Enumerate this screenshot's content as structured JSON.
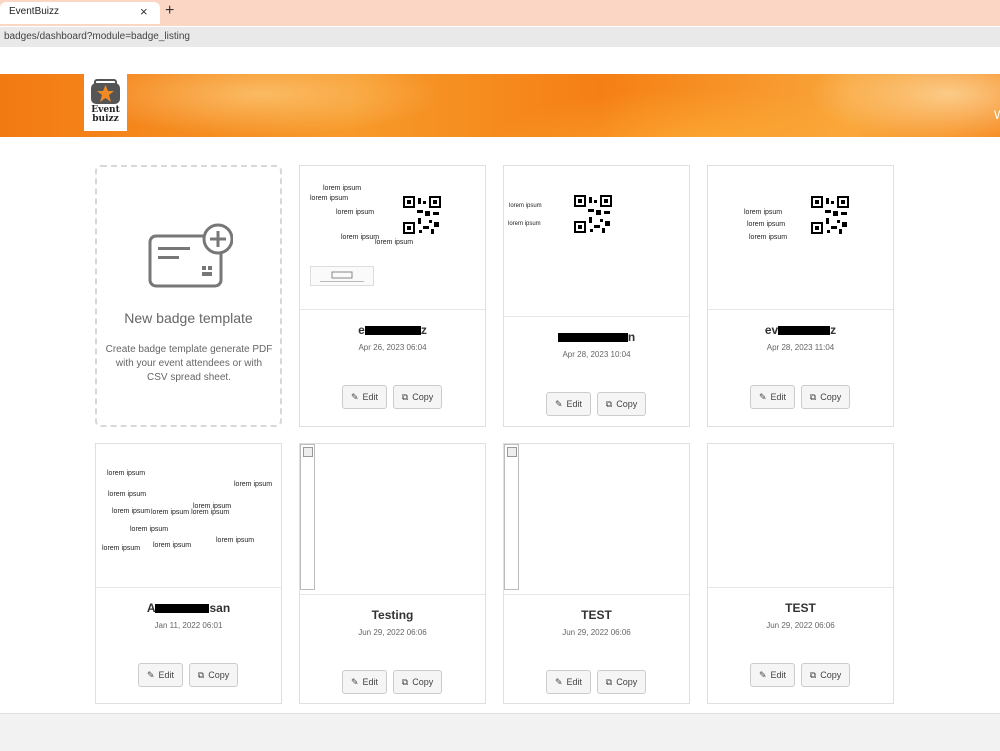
{
  "browser": {
    "tab_title": "EventBuizz",
    "tab_close": "×",
    "new_tab": "+",
    "url": "badges/dashboard?module=badge_listing"
  },
  "header": {
    "logo_line1": "Event",
    "logo_line2": "buizz",
    "edge_text": "W"
  },
  "new_badge": {
    "title": "New badge template",
    "description": "Create badge template generate PDF with your event attendees or with CSV spread sheet."
  },
  "buttons": {
    "edit": "Edit",
    "copy": "Copy"
  },
  "lorem": "lorem ipsum",
  "lorem_triple": "lorem ipsum lorem ipsum",
  "badges": [
    {
      "name_prefix": "e",
      "name_suffix": "z",
      "date": "Apr 26, 2023 06:04"
    },
    {
      "name_prefix": "",
      "name_suffix": "n",
      "date": "Apr 28, 2023 10:04"
    },
    {
      "name_prefix": "ev",
      "name_suffix": "z",
      "date": "Apr 28, 2023 11:04"
    },
    {
      "name_prefix": "A",
      "name_suffix": "san",
      "date": "Jan 11, 2022 06:01"
    },
    {
      "name": "Testing",
      "date": "Jun 29, 2022 06:06"
    },
    {
      "name": "TEST",
      "date": "Jun 29, 2022 06:06"
    },
    {
      "name": "TEST",
      "date": "Jun 29, 2022 06:06"
    }
  ],
  "colors": {
    "banner": "#f37a13",
    "tabbar": "#fbd6c4"
  }
}
